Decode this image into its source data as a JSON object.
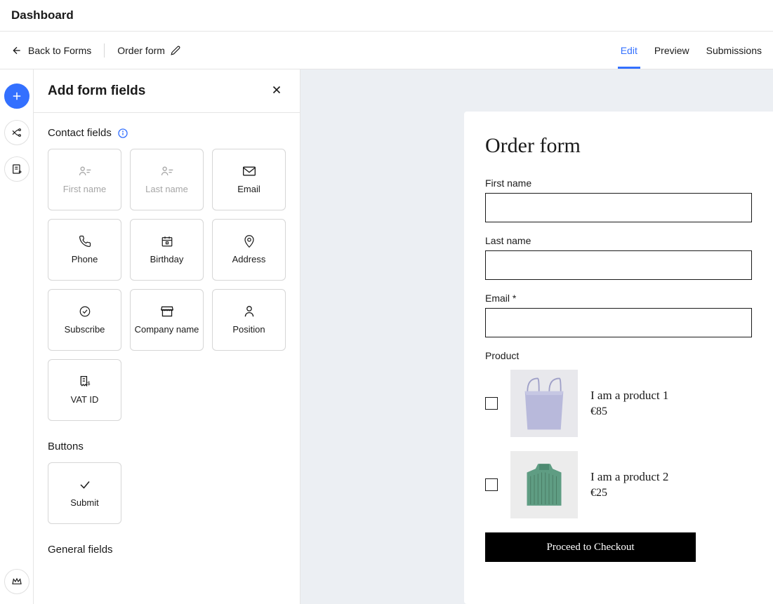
{
  "header": {
    "title": "Dashboard",
    "back_label": "Back to Forms",
    "form_name": "Order form"
  },
  "tabs": {
    "edit": "Edit",
    "preview": "Preview",
    "submissions": "Submissions"
  },
  "panel": {
    "title": "Add form fields",
    "sections": {
      "contact": "Contact fields",
      "buttons": "Buttons",
      "general": "General fields"
    },
    "fields": {
      "first_name": "First name",
      "last_name": "Last name",
      "email": "Email",
      "phone": "Phone",
      "birthday": "Birthday",
      "address": "Address",
      "subscribe": "Subscribe",
      "company": "Company name",
      "position": "Position",
      "vat": "VAT ID",
      "submit": "Submit"
    }
  },
  "form": {
    "title": "Order form",
    "first_name_label": "First name",
    "last_name_label": "Last name",
    "email_label": "Email *",
    "product_label": "Product",
    "products": [
      {
        "name": "I am a product 1",
        "price": "€85"
      },
      {
        "name": "I am a product 2",
        "price": "€25"
      }
    ],
    "checkout": "Proceed to Checkout"
  }
}
